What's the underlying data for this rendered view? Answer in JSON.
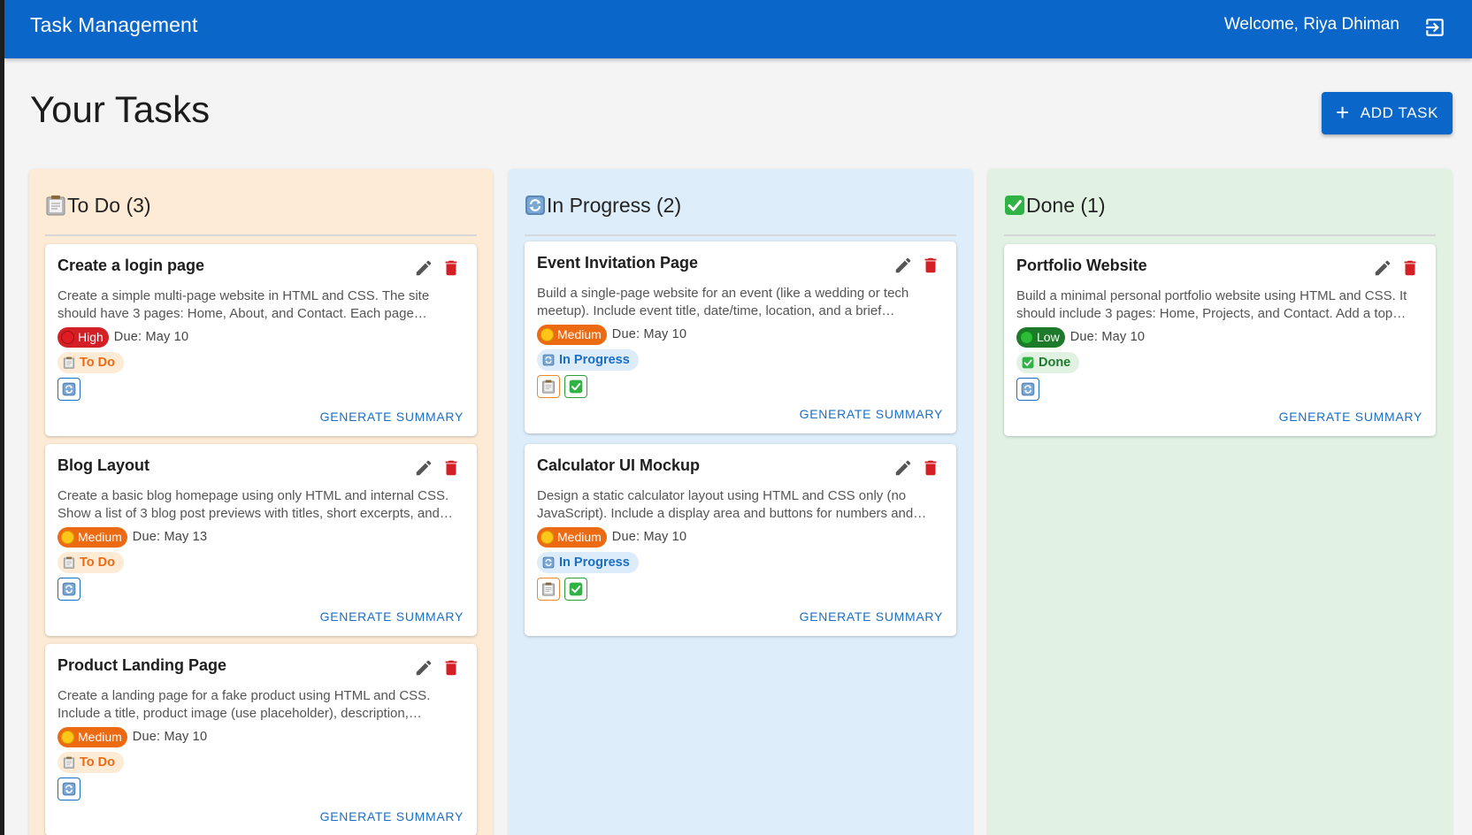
{
  "app": {
    "title": "Task Management",
    "welcome": "Welcome, Riya Dhiman"
  },
  "page": {
    "title": "Your Tasks",
    "add_task_label": "ADD TASK"
  },
  "colors": {
    "primary": "#0a66c8",
    "high": "#d32027",
    "medium": "#ec6a12",
    "low": "#1e7a2b",
    "todo_bg": "#fdebd6",
    "progress_bg": "#ddedfa",
    "done_bg": "#e1f2e3"
  },
  "columns": [
    {
      "title": "To Do (3)",
      "icon": "clipboard-icon",
      "cards": [
        {
          "title": "Create a login page",
          "desc_line1": "Create a simple multi-page website in HTML and CSS. The site",
          "desc_line2": "should have 3 pages: Home, About, and Contact. Each page…",
          "priority": "High",
          "due": "Due: May 10",
          "status": "To Do",
          "action": "GENERATE SUMMARY"
        },
        {
          "title": "Blog Layout",
          "desc_line1": "Create a basic blog homepage using only HTML and internal CSS.",
          "desc_line2": "Show a list of 3 blog post previews with titles, short excerpts, and…",
          "priority": "Medium",
          "due": "Due: May 13",
          "status": "To Do",
          "action": "GENERATE SUMMARY"
        },
        {
          "title": "Product Landing Page",
          "desc_line1": "Create a landing page for a fake product using HTML and CSS.",
          "desc_line2": "Include a title, product image (use placeholder), description,…",
          "priority": "Medium",
          "due": "Due: May 10",
          "status": "To Do",
          "action": "GENERATE SUMMARY"
        }
      ]
    },
    {
      "title": "In Progress (2)",
      "icon": "refresh-icon",
      "cards": [
        {
          "title": "Event Invitation Page",
          "desc_line1": "Build a single-page website for an event (like a wedding or tech",
          "desc_line2": "meetup). Include event title, date/time, location, and a brief…",
          "priority": "Medium",
          "due": "Due: May 10",
          "status": "In Progress",
          "action": "GENERATE SUMMARY"
        },
        {
          "title": "Calculator UI Mockup",
          "desc_line1": "Design a static calculator layout using HTML and CSS only (no",
          "desc_line2": "JavaScript). Include a display area and buttons for numbers and…",
          "priority": "Medium",
          "due": "Due: May 10",
          "status": "In Progress",
          "action": "GENERATE SUMMARY"
        }
      ]
    },
    {
      "title": "Done (1)",
      "icon": "check-icon",
      "cards": [
        {
          "title": "Portfolio Website",
          "desc_line1": "Build a minimal personal portfolio website using HTML and CSS. It",
          "desc_line2": "should include 3 pages: Home, Projects, and Contact. Add a top…",
          "priority": "Low",
          "due": "Due: May 10",
          "status": "Done",
          "action": "GENERATE SUMMARY"
        }
      ]
    }
  ]
}
